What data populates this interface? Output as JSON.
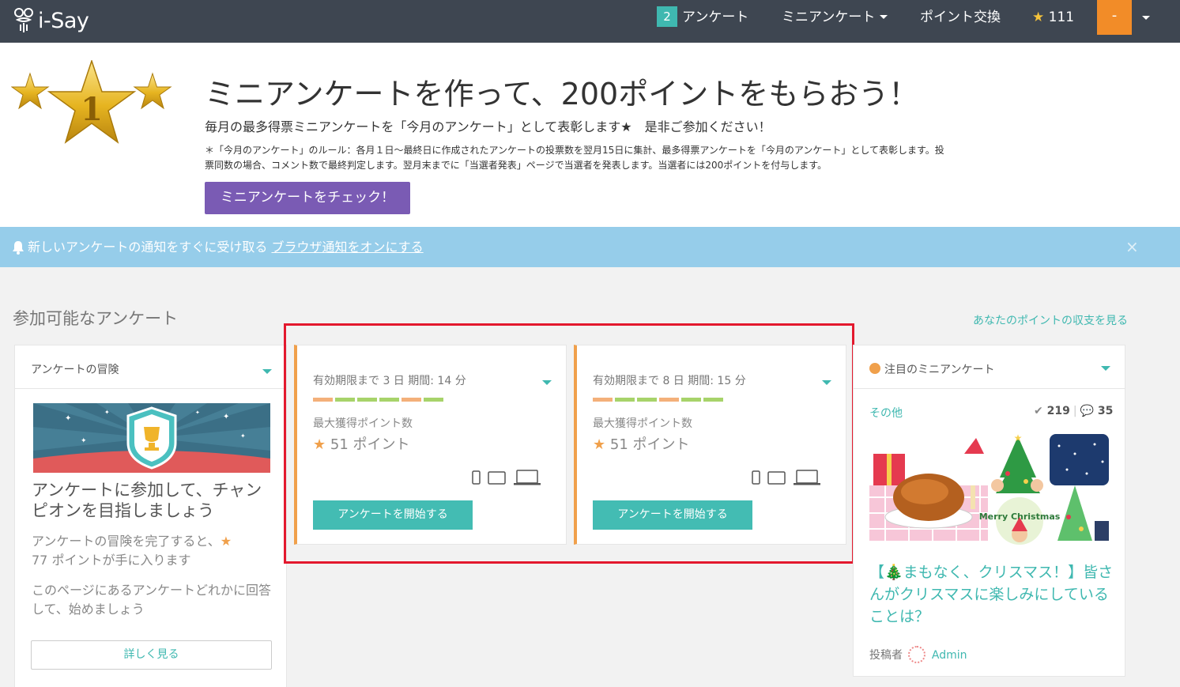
{
  "nav": {
    "logo_text": "i-Say",
    "survey_count": "2",
    "survey_label": "アンケート",
    "mini_label": "ミニアンケート",
    "exchange_label": "ポイント交換",
    "star": "★",
    "points": "111",
    "avatar_text": "-"
  },
  "hero": {
    "star_number": "1",
    "title": "ミニアンケートを作って、200ポイントをもらおう！",
    "subtitle": "毎月の最多得票ミニアンケートを「今月のアンケート」として表彰します★　是非ご参加ください！",
    "rules": "＊「今月のアンケート」のルール：各月１日〜最終日に作成されたアンケートの投票数を翌月15日に集計、最多得票アンケートを「今月のアンケート」として表彰します。投票同数の場合、コメント数で最終判定します。翌月末までに「当選者発表」ページで当選者を発表します。当選者には200ポイントを付与します。",
    "button": "ミニアンケートをチェック！"
  },
  "notice": {
    "text": "新しいアンケートの通知をすぐに受け取る",
    "link": "ブラウザ通知をオンにする",
    "close": "×"
  },
  "section": {
    "title": "参加可能なアンケート",
    "points_link": "あなたのポイントの収支を見る"
  },
  "adventure": {
    "head": "アンケートの冒険",
    "title": "アンケートに参加して、チャンピオンを目指しましょう",
    "body_a": "アンケートの冒険を完了すると、",
    "body_b": "77 ポイントが手に入ります",
    "body2": "このページにあるアンケートどれかに回答して、始めましょう",
    "button": "詳しく見る"
  },
  "surveys": [
    {
      "expire": "有効期限まで 3 日 期間: 14 分",
      "max_label": "最大獲得ポイント数",
      "points": "51 ポイント",
      "button": "アンケートを開始する"
    },
    {
      "expire": "有効期限まで 8 日 期間: 15 分",
      "max_label": "最大獲得ポイント数",
      "points": "51 ポイント",
      "button": "アンケートを開始する"
    }
  ],
  "mini": {
    "head": "注目のミニアンケート",
    "category": "その他",
    "votes": "219",
    "comments": "35",
    "image_text": "Merry Christmas",
    "title": "【🎄まもなく、クリスマス！】皆さんがクリスマスに楽しみにしていることは？",
    "author_label": "投稿者",
    "author": "Admin"
  },
  "colors": {
    "nav_bg": "#3e4651",
    "teal": "#3fb8b0",
    "purple": "#7a5bb4",
    "orange": "#f0a04b",
    "notice_bg": "#96cdea",
    "highlight": "#e3192e"
  }
}
